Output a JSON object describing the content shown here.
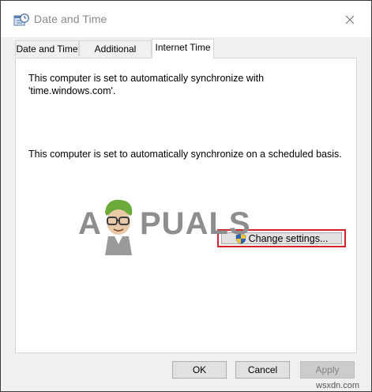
{
  "window": {
    "title": "Date and Time",
    "icon": "clock-calendar-icon",
    "close_icon": "close-icon"
  },
  "tabs": [
    {
      "label": "Date and Time",
      "active": false
    },
    {
      "label": "Additional Clocks",
      "active": false
    },
    {
      "label": "Internet Time",
      "active": true
    }
  ],
  "panel": {
    "sync_line1": "This computer is set to automatically synchronize with",
    "sync_line2": "'time.windows.com'.",
    "schedule_text": "This computer is set to automatically synchronize on a scheduled basis.",
    "change_settings_label": "Change settings...",
    "change_settings_icon": "uac-shield-icon",
    "highlight_color": "#d2232a"
  },
  "watermark": {
    "text_a": "A",
    "text_rest": "PUALS"
  },
  "buttons": {
    "ok": "OK",
    "cancel": "Cancel",
    "apply": "Apply",
    "apply_enabled": false
  },
  "site_credit": "wsxdn.com"
}
